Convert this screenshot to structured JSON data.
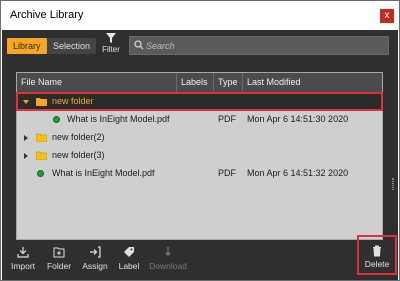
{
  "window": {
    "title": "Archive Library",
    "close_glyph": "x"
  },
  "tabs": [
    {
      "label": "Library",
      "active": true
    },
    {
      "label": "Selection",
      "active": false
    }
  ],
  "filter": {
    "label": "Filter",
    "icon": "filter-icon"
  },
  "search": {
    "placeholder": "Search",
    "value": "",
    "icon": "search-icon"
  },
  "table": {
    "columns": [
      "File Name",
      "Labels",
      "Type",
      "Last Modified"
    ],
    "rows": [
      {
        "name": "new folder",
        "kind": "folder",
        "expanded": true,
        "selected": true,
        "labels": "",
        "type": "",
        "modified": ""
      },
      {
        "name": "What is InEight Model.pdf",
        "kind": "file",
        "labels": "",
        "type": "PDF",
        "modified": "Mon Apr 6 14:51:30 2020"
      },
      {
        "name": "new folder(2)",
        "kind": "folder",
        "expanded": false,
        "labels": "",
        "type": "",
        "modified": ""
      },
      {
        "name": "new folder(3)",
        "kind": "folder",
        "expanded": false,
        "labels": "",
        "type": "",
        "modified": ""
      },
      {
        "name": "What is InEight Model.pdf",
        "kind": "file",
        "labels": "",
        "type": "PDF",
        "modified": "Mon Apr 6 14:51:32 2020"
      }
    ]
  },
  "actions": {
    "import": "Import",
    "folder": "Folder",
    "assign": "Assign",
    "label": "Label",
    "download": "Download",
    "delete": "Delete"
  },
  "colors": {
    "accent": "#f5a623",
    "selection_outline": "#e0303a",
    "status_dot": "#1fa02e",
    "background": "#2f2f2f"
  }
}
